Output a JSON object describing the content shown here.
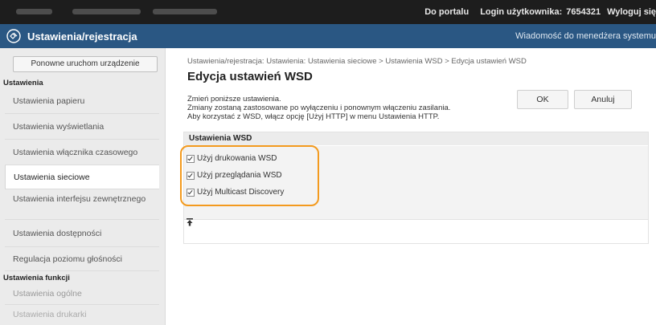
{
  "topbar": {
    "portal_link": "Do portalu",
    "user_label": "Login użytkownika:",
    "user_id": "7654321",
    "logout_link": "Wyloguj się"
  },
  "titlebar": {
    "title": "Ustawienia/rejestracja",
    "message_link": "Wiadomość do menedżera systemu"
  },
  "sidebar": {
    "restart_button": "Ponowne uruchom urządzenie",
    "section_settings": "Ustawienia",
    "items": [
      "Ustawienia papieru",
      "Ustawienia wyświetlania",
      "Ustawienia włącznika czasowego",
      "Ustawienia sieciowe",
      "Ustawienia interfejsu zewnętrznego",
      "Ustawienia dostępności",
      "Regulacja poziomu głośności"
    ],
    "section_functions": "Ustawienia funkcji",
    "function_items": [
      "Ustawienia ogólne",
      "Ustawienia drukarki"
    ]
  },
  "main": {
    "breadcrumb": "Ustawienia/rejestracja: Ustawienia: Ustawienia sieciowe > Ustawienia WSD > Edycja ustawień WSD",
    "title": "Edycja ustawień WSD",
    "info_lines": [
      "Zmień poniższe ustawienia.",
      "Zmiany zostaną zastosowane po wyłączeniu i ponownym włączeniu zasilania.",
      "Aby korzystać z WSD, włącz opcję [Użyj HTTP] w menu Ustawienia HTTP."
    ],
    "ok_button": "OK",
    "cancel_button": "Anuluj",
    "section_title": "Ustawienia WSD",
    "checkboxes": [
      {
        "label": "Użyj drukowania WSD",
        "checked": true
      },
      {
        "label": "Użyj przeglądania WSD",
        "checked": true
      },
      {
        "label": "Użyj Multicast Discovery",
        "checked": true
      }
    ]
  },
  "colors": {
    "topbar": "#1d1d1d",
    "titlebar": "#2a5783",
    "highlight": "#f39a1e",
    "sidebar": "#ebebeb"
  }
}
